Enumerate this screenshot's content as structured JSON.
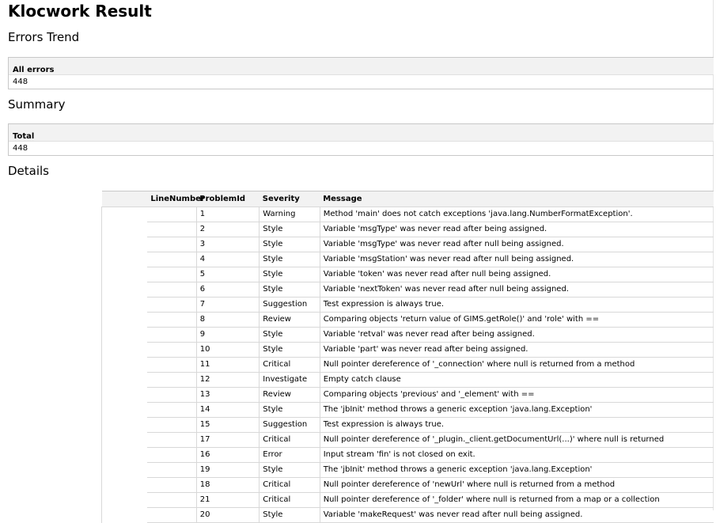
{
  "page": {
    "title": "Klocwork Result"
  },
  "errors_trend": {
    "heading": "Errors Trend",
    "column": "All errors",
    "value": "448"
  },
  "summary": {
    "heading": "Summary",
    "column": "Total",
    "value": "448"
  },
  "details": {
    "heading": "Details",
    "columns": [
      "LineNumber",
      "ProblemId",
      "Severity",
      "Message"
    ],
    "rows": [
      {
        "line": "",
        "problem_id": "1",
        "severity": "Warning",
        "message": "Method 'main' does not catch exceptions 'java.lang.NumberFormatException'."
      },
      {
        "line": "",
        "problem_id": "2",
        "severity": "Style",
        "message": "Variable 'msgType' was never read after being assigned."
      },
      {
        "line": "",
        "problem_id": "3",
        "severity": "Style",
        "message": "Variable 'msgType' was never read after null being assigned."
      },
      {
        "line": "",
        "problem_id": "4",
        "severity": "Style",
        "message": "Variable 'msgStation' was never read after null being assigned."
      },
      {
        "line": "",
        "problem_id": "5",
        "severity": "Style",
        "message": "Variable 'token' was never read after null being assigned."
      },
      {
        "line": "",
        "problem_id": "6",
        "severity": "Style",
        "message": "Variable 'nextToken' was never read after null being assigned."
      },
      {
        "line": "",
        "problem_id": "7",
        "severity": "Suggestion",
        "message": "Test expression is always true."
      },
      {
        "line": "",
        "problem_id": "8",
        "severity": "Review",
        "message": "Comparing objects 'return value of GIMS.getRole()' and 'role' with =="
      },
      {
        "line": "",
        "problem_id": "9",
        "severity": "Style",
        "message": "Variable 'retval' was never read after being assigned."
      },
      {
        "line": "",
        "problem_id": "10",
        "severity": "Style",
        "message": "Variable 'part' was never read after being assigned."
      },
      {
        "line": "",
        "problem_id": "11",
        "severity": "Critical",
        "message": "Null pointer dereference of '_connection' where null is returned from a method"
      },
      {
        "line": "",
        "problem_id": "12",
        "severity": "Investigate",
        "message": "Empty catch clause"
      },
      {
        "line": "",
        "problem_id": "13",
        "severity": "Review",
        "message": "Comparing objects 'previous' and '_element' with =="
      },
      {
        "line": "",
        "problem_id": "14",
        "severity": "Style",
        "message": "The 'jbInit' method throws a generic exception 'java.lang.Exception'"
      },
      {
        "line": "",
        "problem_id": "15",
        "severity": "Suggestion",
        "message": "Test expression is always true."
      },
      {
        "line": "",
        "problem_id": "17",
        "severity": "Critical",
        "message": "Null pointer dereference of '_plugin._client.getDocumentUrl(...)' where null is returned"
      },
      {
        "line": "",
        "problem_id": "16",
        "severity": "Error",
        "message": "Input stream 'fin' is not closed on exit."
      },
      {
        "line": "",
        "problem_id": "19",
        "severity": "Style",
        "message": "The 'jbInit' method throws a generic exception 'java.lang.Exception'"
      },
      {
        "line": "",
        "problem_id": "18",
        "severity": "Critical",
        "message": "Null pointer dereference of 'newUrl' where null is returned from a method"
      },
      {
        "line": "",
        "problem_id": "21",
        "severity": "Critical",
        "message": "Null pointer dereference of '_folder' where null is returned from a map or a collection"
      },
      {
        "line": "",
        "problem_id": "20",
        "severity": "Style",
        "message": "Variable 'makeRequest' was never read after null being assigned."
      }
    ]
  }
}
